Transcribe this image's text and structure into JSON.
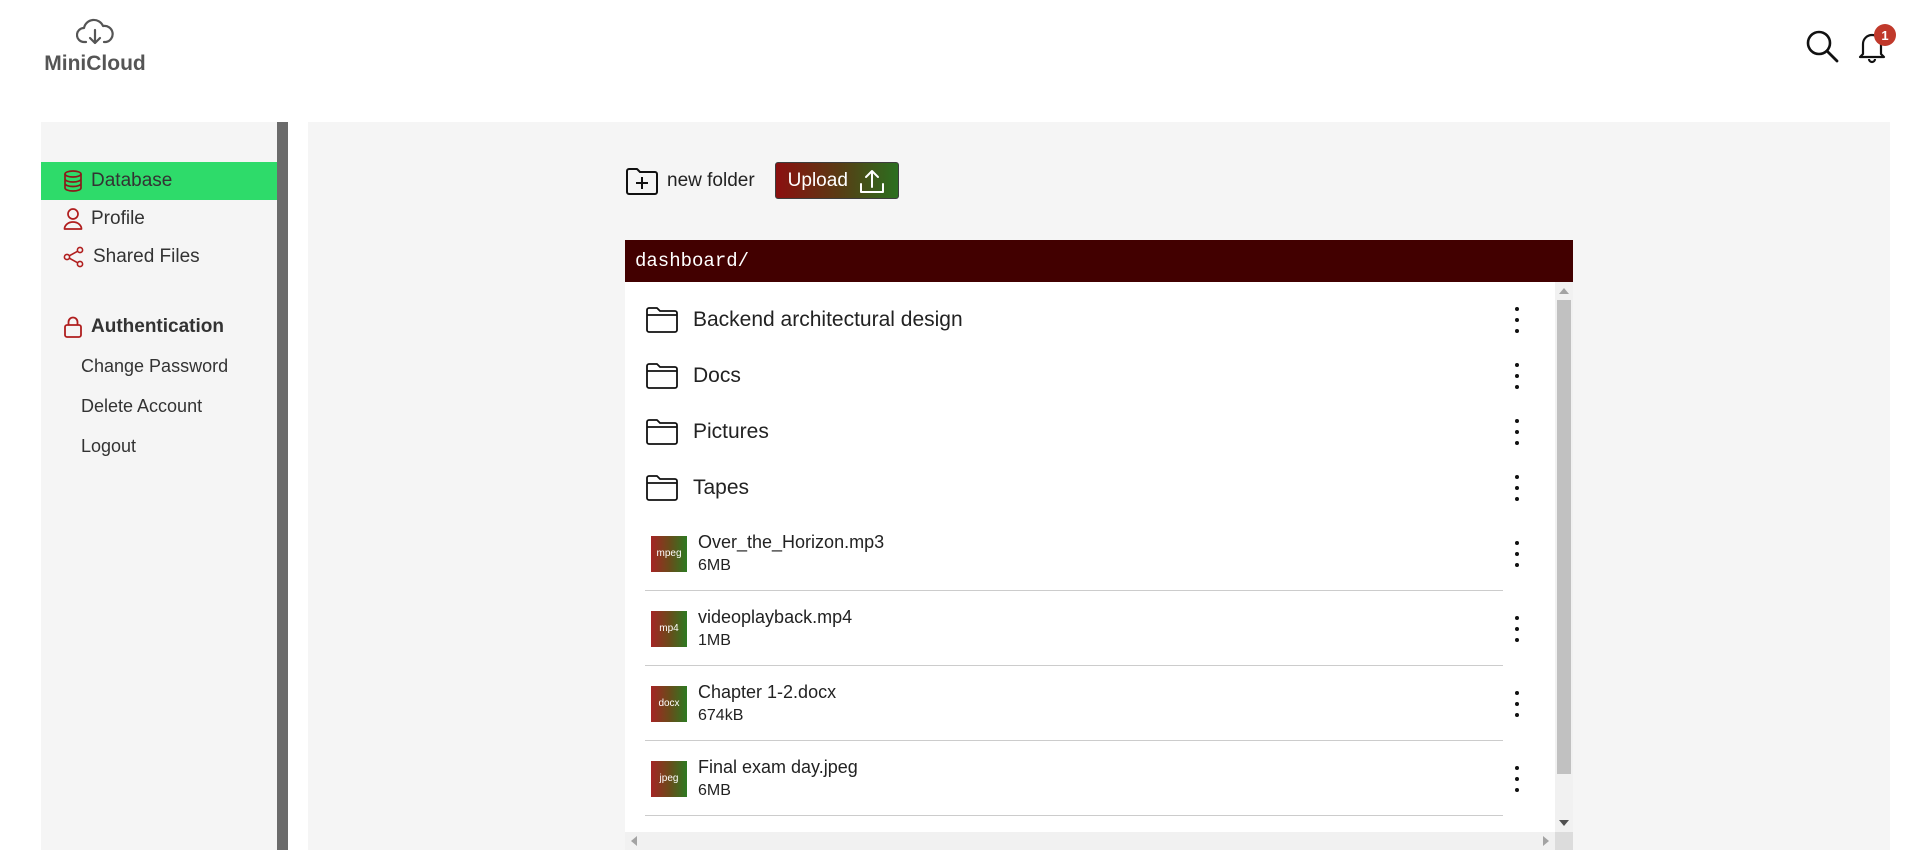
{
  "app": {
    "name": "MiniCloud",
    "logo_icon": "cloud-download-icon",
    "notification_count": "1",
    "accent_active": "#2edb6a",
    "path_bar_color": "#420000"
  },
  "sidebar": {
    "items": [
      {
        "label": "Database",
        "icon": "database-icon",
        "active": true
      },
      {
        "label": "Profile",
        "icon": "user-icon",
        "active": false
      },
      {
        "label": "Shared Files",
        "icon": "share-icon",
        "active": false
      }
    ],
    "auth": {
      "heading": "Authentication",
      "icon": "lock-icon",
      "items": [
        "Change Password",
        "Delete Account",
        "Logout"
      ]
    }
  },
  "toolbar": {
    "new_folder_label": "new folder",
    "upload_label": "Upload"
  },
  "browser": {
    "path": "dashboard/",
    "folders": [
      {
        "name": "Backend architectural design"
      },
      {
        "name": "Docs"
      },
      {
        "name": "Pictures"
      },
      {
        "name": "Tapes"
      }
    ],
    "files": [
      {
        "type": "mpeg",
        "name": "Over_the_Horizon.mp3",
        "size": "6MB"
      },
      {
        "type": "mp4",
        "name": "videoplayback.mp4",
        "size": "1MB"
      },
      {
        "type": "docx",
        "name": "Chapter 1-2.docx",
        "size": "674kB"
      },
      {
        "type": "jpeg",
        "name": "Final exam day.jpeg",
        "size": "6MB"
      }
    ]
  }
}
